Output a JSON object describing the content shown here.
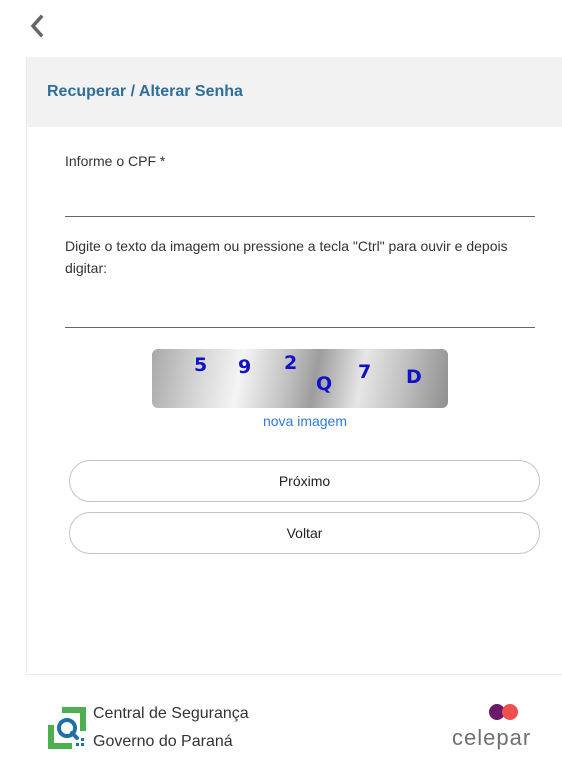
{
  "header": {
    "back_icon": "chevron-left-icon",
    "title": "Recuperar / Alterar Senha"
  },
  "form": {
    "cpf_label": "Informe o CPF *",
    "cpf_value": "",
    "captcha_instruction": "Digite o texto da imagem ou pressione a tecla \"Ctrl\" para ouvir e depois digitar:",
    "captcha_value": "",
    "captcha_chars": [
      "5",
      "9",
      "2",
      "Q",
      "7",
      "D"
    ],
    "new_image_link": "nova imagem"
  },
  "buttons": {
    "next": "Próximo",
    "back": "Voltar"
  },
  "footer": {
    "line1": "Central de Segurança",
    "line2": "Governo do Paraná",
    "brand": "celepar",
    "colors": {
      "accent_dark": "#6b1a6b",
      "accent_red": "#ef4f4f",
      "logo_green": "#4caf50",
      "logo_blue": "#1e6fa8"
    }
  },
  "colors": {
    "title": "#2f6e9a",
    "link": "#2e7bd6",
    "captcha_text": "#1010c8"
  }
}
